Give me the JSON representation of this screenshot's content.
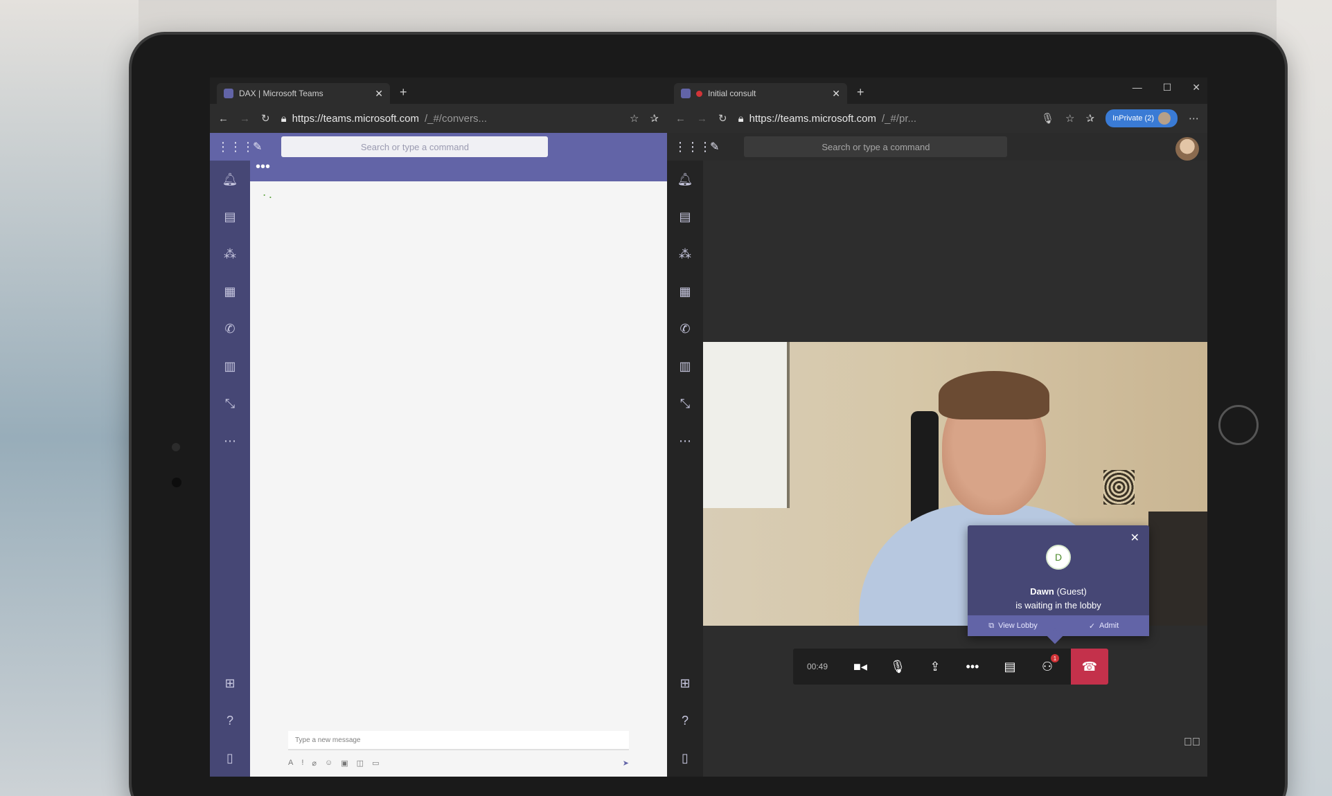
{
  "left_window": {
    "tab_title": "DAX | Microsoft Teams",
    "url_main": "https://teams.microsoft.com",
    "url_dim": "/_#/convers...",
    "search_placeholder": "Search or type a command",
    "chat_dots": "•••",
    "compose_placeholder": "Type a new message",
    "rail": [
      "bell-icon",
      "chat-icon",
      "teams-icon",
      "calendar-icon",
      "calls-icon",
      "files-icon",
      "dax-icon",
      "more-icon"
    ]
  },
  "right_window": {
    "tab_title": "Initial consult",
    "url_main": "https://teams.microsoft.com",
    "url_dim": "/_#/pr...",
    "inprivate_label": "InPrivate (2)",
    "search_placeholder": "Search or type a command",
    "lobby": {
      "avatar_letter": "D",
      "guest_name": "Dawn",
      "guest_suffix": "(Guest)",
      "message": "is waiting in the lobby",
      "view_lobby": "View Lobby",
      "admit": "Admit"
    },
    "call": {
      "timer": "00:49",
      "participants_badge": "1"
    }
  },
  "colors": {
    "teams_purple": "#6264a7",
    "rail_purple": "#464775",
    "hangup_red": "#c4314b"
  }
}
